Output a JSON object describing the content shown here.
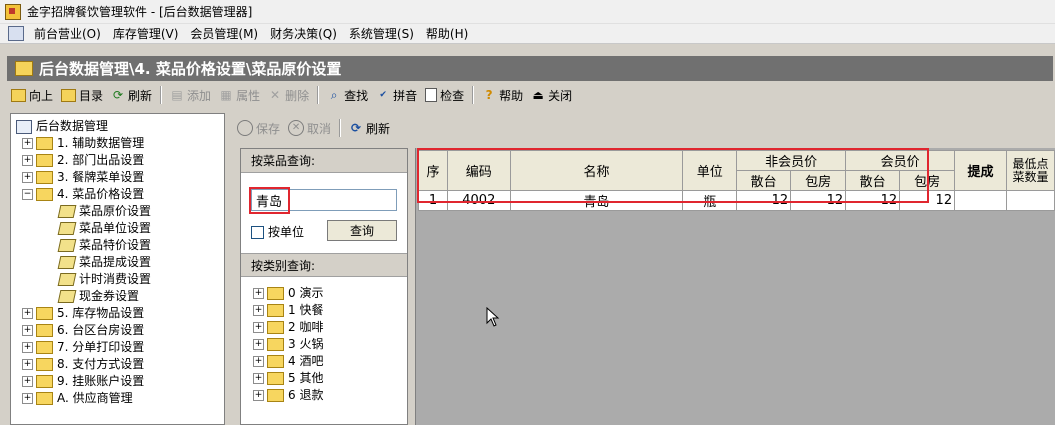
{
  "window": {
    "title": "金字招牌餐饮管理软件 - [后台数据管理器]"
  },
  "menu": [
    "前台营业(O)",
    "库存管理(V)",
    "会员管理(M)",
    "财务决策(Q)",
    "系统管理(S)",
    "帮助(H)"
  ],
  "breadcrumb": "后台数据管理\\4. 菜品价格设置\\菜品原价设置",
  "toolbar": {
    "up": "向上",
    "catalog": "目录",
    "refresh": "刷新",
    "add": "添加",
    "properties": "属性",
    "delete": "删除",
    "find": "查找",
    "pinyin": "拼音",
    "check": "检查",
    "help": "帮助",
    "close": "关闭"
  },
  "tree": {
    "root": "后台数据管理",
    "items": [
      "1. 辅助数据管理",
      "2. 部门出品设置",
      "3. 餐牌菜单设置",
      "4. 菜品价格设置",
      "菜品原价设置",
      "菜品单位设置",
      "菜品特价设置",
      "菜品提成设置",
      "计时消费设置",
      "现金券设置",
      "5. 库存物品设置",
      "6. 台区台房设置",
      "7. 分单打印设置",
      "8. 支付方式设置",
      "9. 挂账账户设置",
      "A. 供应商管理"
    ]
  },
  "subtoolbar": {
    "save": "保存",
    "cancel": "取消",
    "refresh": "刷新"
  },
  "query": {
    "dish_header": "按菜品查询:",
    "dish_value": "青岛",
    "by_unit": "按单位",
    "query_button": "查询",
    "category_header": "按类别查询:",
    "categories": [
      "0 演示",
      "1 快餐",
      "2 咖啡",
      "3 火锅",
      "4 酒吧",
      "5 其他",
      "6 退款"
    ]
  },
  "grid": {
    "headers": {
      "seq": "序",
      "code": "编码",
      "name": "名称",
      "unit": "单位",
      "non_member": "非会员价",
      "member": "会员价",
      "hall": "散台",
      "room": "包房",
      "commission": "提成",
      "min_qty": "最低点菜数量"
    },
    "rows": [
      {
        "seq": "1",
        "code": "4002",
        "name": "青岛",
        "unit": "瓶",
        "non_member_hall": "12",
        "non_member_room": "12",
        "member_hall": "12",
        "member_room": "12",
        "commission": "",
        "min_qty": ""
      }
    ]
  }
}
